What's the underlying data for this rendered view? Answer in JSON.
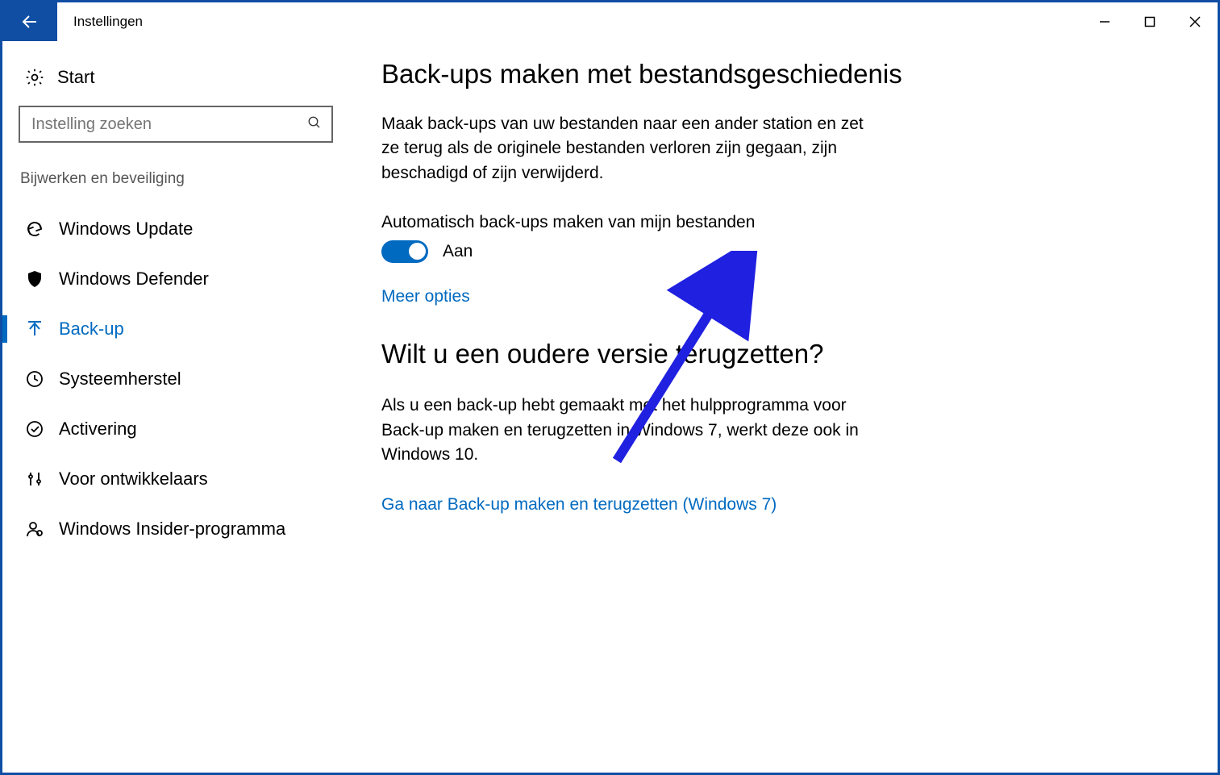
{
  "window": {
    "title": "Instellingen"
  },
  "sidebar": {
    "start_label": "Start",
    "search_placeholder": "Instelling zoeken",
    "category": "Bijwerken en beveiliging",
    "items": [
      {
        "icon": "refresh-icon",
        "label": "Windows Update"
      },
      {
        "icon": "shield-icon",
        "label": "Windows Defender"
      },
      {
        "icon": "backup-icon",
        "label": "Back-up"
      },
      {
        "icon": "history-icon",
        "label": "Systeemherstel"
      },
      {
        "icon": "check-circle-icon",
        "label": "Activering"
      },
      {
        "icon": "sliders-icon",
        "label": "Voor ontwikkelaars"
      },
      {
        "icon": "person-badge-icon",
        "label": "Windows Insider-programma"
      }
    ],
    "active_index": 2
  },
  "main": {
    "h1": "Back-ups maken met bestandsgeschiedenis",
    "para1": "Maak back-ups van uw bestanden naar een ander station en zet ze terug als de originele bestanden verloren zijn gegaan, zijn beschadigd of zijn verwijderd.",
    "auto_backup_label": "Automatisch back-ups maken van mijn bestanden",
    "toggle_state": "Aan",
    "toggle_on": true,
    "more_options_link": "Meer opties",
    "h2": "Wilt u een oudere versie terugzetten?",
    "para2": "Als u een back-up hebt gemaakt met het hulpprogramma voor Back-up maken en terugzetten in Windows 7, werkt deze ook in Windows 10.",
    "restore_link": "Ga naar Back-up maken en terugzetten (Windows 7)"
  },
  "colors": {
    "accent": "#006ac0",
    "frame": "#0f4ea3"
  }
}
